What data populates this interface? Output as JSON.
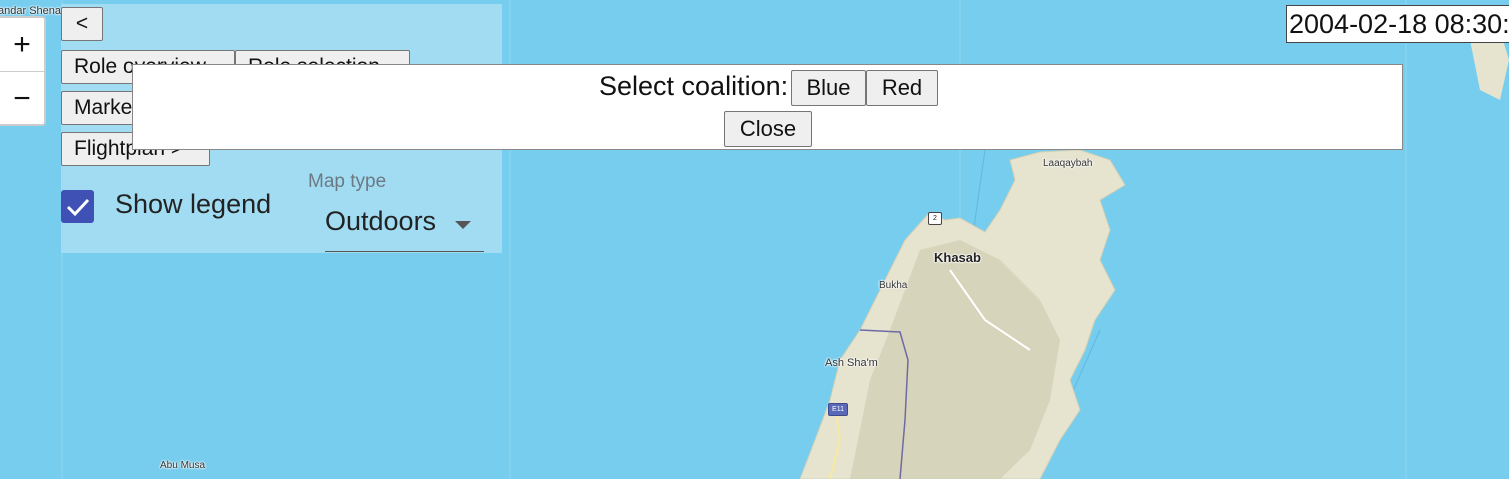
{
  "map": {
    "labels": {
      "bandar": "andar Shena",
      "laaqaybah": "Laaqaybah",
      "khasab": "Khasab",
      "bukha": "Bukha",
      "ash_sham": "Ash Sha'm",
      "abu_musa": "Abu Musa"
    },
    "road_badges": {
      "khasab_road": "2",
      "coastal_road": "E11"
    },
    "colors": {
      "sea": "#76cdee",
      "land": "#e8e4d2",
      "terrain": "#c9c8a4"
    }
  },
  "zoom": {
    "in_icon": "+",
    "out_icon": "−"
  },
  "panel": {
    "back_label": "<",
    "role_overview_label": "Role overview",
    "role_selection_label": "Role selection",
    "markers_label": "Markers",
    "flightplan_label": "Flightplan >",
    "show_legend": {
      "label": "Show legend",
      "checked": true
    },
    "map_type": {
      "label": "Map type",
      "value": "Outdoors"
    }
  },
  "clock": {
    "value": "2004-02-18 08:30:"
  },
  "dialog": {
    "prompt": "Select coalition:",
    "blue_label": "Blue",
    "red_label": "Red",
    "close_label": "Close"
  }
}
